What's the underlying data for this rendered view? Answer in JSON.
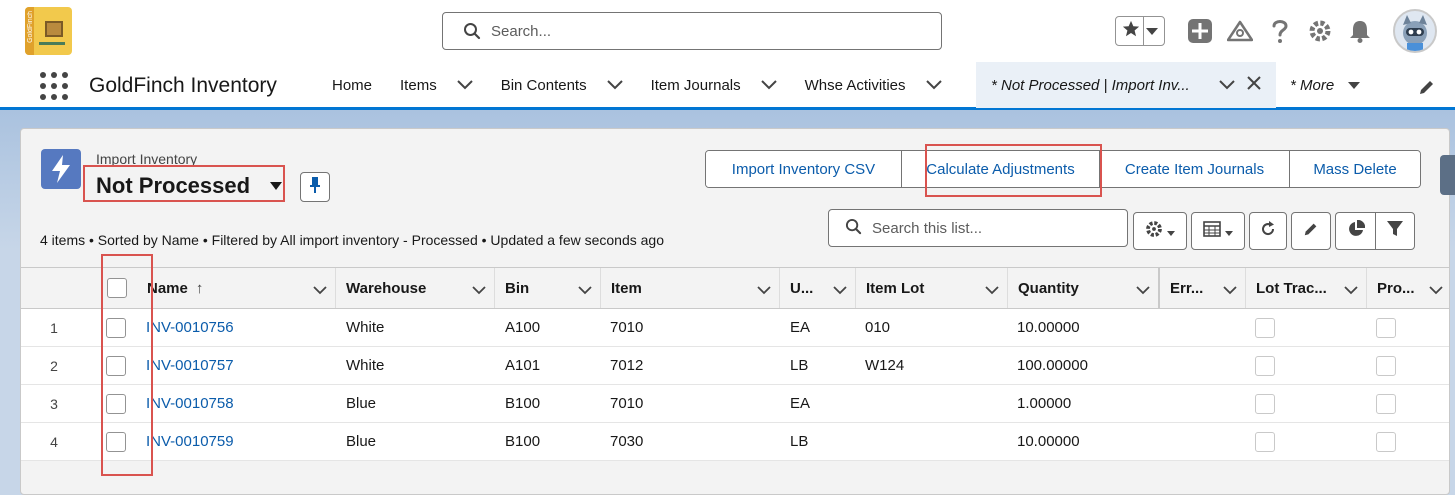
{
  "global_header": {
    "logo_text": "GoldFinch",
    "search_placeholder": "Search...",
    "tools": [
      "favorites-star-icon",
      "add-icon",
      "trailhead-icon",
      "help-icon",
      "setup-gear-icon",
      "notifications-bell-icon",
      "user-avatar"
    ]
  },
  "nav": {
    "app_name": "GoldFinch Inventory",
    "items": [
      {
        "label": "Home",
        "has_menu": false
      },
      {
        "label": "Items",
        "has_menu": true
      },
      {
        "label": "Bin Contents",
        "has_menu": true
      },
      {
        "label": "Item Journals",
        "has_menu": true
      },
      {
        "label": "Whse Activities",
        "has_menu": true
      }
    ],
    "active_tab": "* Not Processed | Import Inv...",
    "more": "* More"
  },
  "list_view": {
    "object_label": "Import Inventory",
    "view_name": "Not Processed",
    "actions": [
      "Import Inventory CSV",
      "Calculate Adjustments",
      "Create Item Journals",
      "Mass Delete"
    ],
    "info": "4 items • Sorted by Name • Filtered by All import inventory - Processed • Updated a few seconds ago",
    "search_placeholder": "Search this list...",
    "columns": [
      "Name",
      "Warehouse",
      "Bin",
      "Item",
      "U...",
      "Item Lot",
      "Quantity",
      "Err...",
      "Lot Trac...",
      "Pro..."
    ],
    "sorted_column": "Name",
    "rows": [
      {
        "num": "1",
        "name": "INV-0010756",
        "warehouse": "White",
        "bin": "A100",
        "item": "7010",
        "uom": "EA",
        "lot": "010",
        "qty": "10.00000",
        "lot_tracked": false,
        "processed": false
      },
      {
        "num": "2",
        "name": "INV-0010757",
        "warehouse": "White",
        "bin": "A101",
        "item": "7012",
        "uom": "LB",
        "lot": "W124",
        "qty": "100.00000",
        "lot_tracked": false,
        "processed": false
      },
      {
        "num": "3",
        "name": "INV-0010758",
        "warehouse": "Blue",
        "bin": "B100",
        "item": "7010",
        "uom": "EA",
        "lot": "",
        "qty": "1.00000",
        "lot_tracked": false,
        "processed": false
      },
      {
        "num": "4",
        "name": "INV-0010759",
        "warehouse": "Blue",
        "bin": "B100",
        "item": "7030",
        "uom": "LB",
        "lot": "",
        "qty": "10.00000",
        "lot_tracked": false,
        "processed": false
      }
    ]
  },
  "colors": {
    "brand_blue": "#0176d3",
    "link": "#0b5cab",
    "highlight": "#d9534f",
    "object_icon": "#5679c0"
  }
}
